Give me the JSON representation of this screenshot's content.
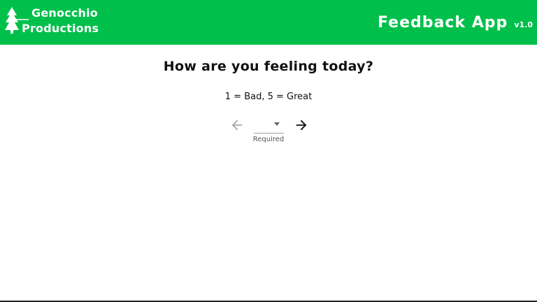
{
  "header": {
    "brand_line1": "Genocchio",
    "brand_line2": "Productions",
    "logo_icon": "pine-tree-icon",
    "app_title": "Feedback App",
    "version": "v1.0"
  },
  "main": {
    "question": "How are you feeling today?",
    "scale_hint": "1 = Bad, 5 = Great",
    "rating_select": {
      "value": "",
      "helper_text": "Required"
    },
    "back_icon": "arrow-left-icon",
    "next_icon": "arrow-right-icon"
  },
  "colors": {
    "header_bg": "#00c04b",
    "header_text": "#ffffff",
    "disabled_arrow": "#a8a8a8",
    "active_arrow": "#111111"
  }
}
